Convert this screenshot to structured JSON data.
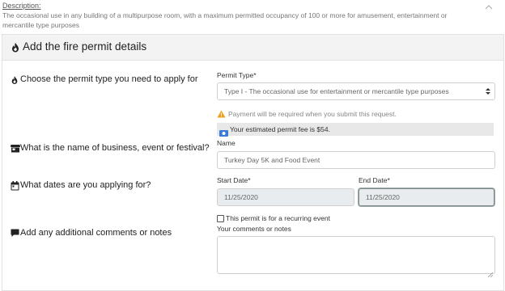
{
  "description": {
    "label": "Description:",
    "text": "The occasional use in any building of a multipurpose room, with a maximum permitted occupancy of 100 or more for amusement, entertainment or mercantile type purposes",
    "collapse_icon": "chevron-up-icon"
  },
  "panel": {
    "title": "Add the fire permit details",
    "icon": "fire-icon"
  },
  "questions": {
    "permit_type": "Choose the permit type you need to apply for",
    "business_name": "What is the name of business, event or festival?",
    "dates": "What dates are you applying for?",
    "comments": "Add any additional comments or notes"
  },
  "permit_type": {
    "label": "Permit Type*",
    "selected": "Type I - The occasional use for entertainment or mercantile type purposes"
  },
  "alerts": {
    "payment_warning": "Payment will be required when you submit this request.",
    "fee": "Your estimated permit fee is $54."
  },
  "name_field": {
    "label": "Name",
    "value": "Turkey Day 5K and Food Event"
  },
  "dates": {
    "start_label": "Start Date*",
    "start_value": "11/25/2020",
    "end_label": "End Date*",
    "end_value": "11/25/2020"
  },
  "recurring": {
    "label": "This permit is for a recurring event",
    "checked": false
  },
  "comments_field": {
    "label": "Your comments or notes",
    "value": ""
  },
  "colors": {
    "warning": "#f0a020",
    "fee_icon": "#3a7bd5"
  }
}
